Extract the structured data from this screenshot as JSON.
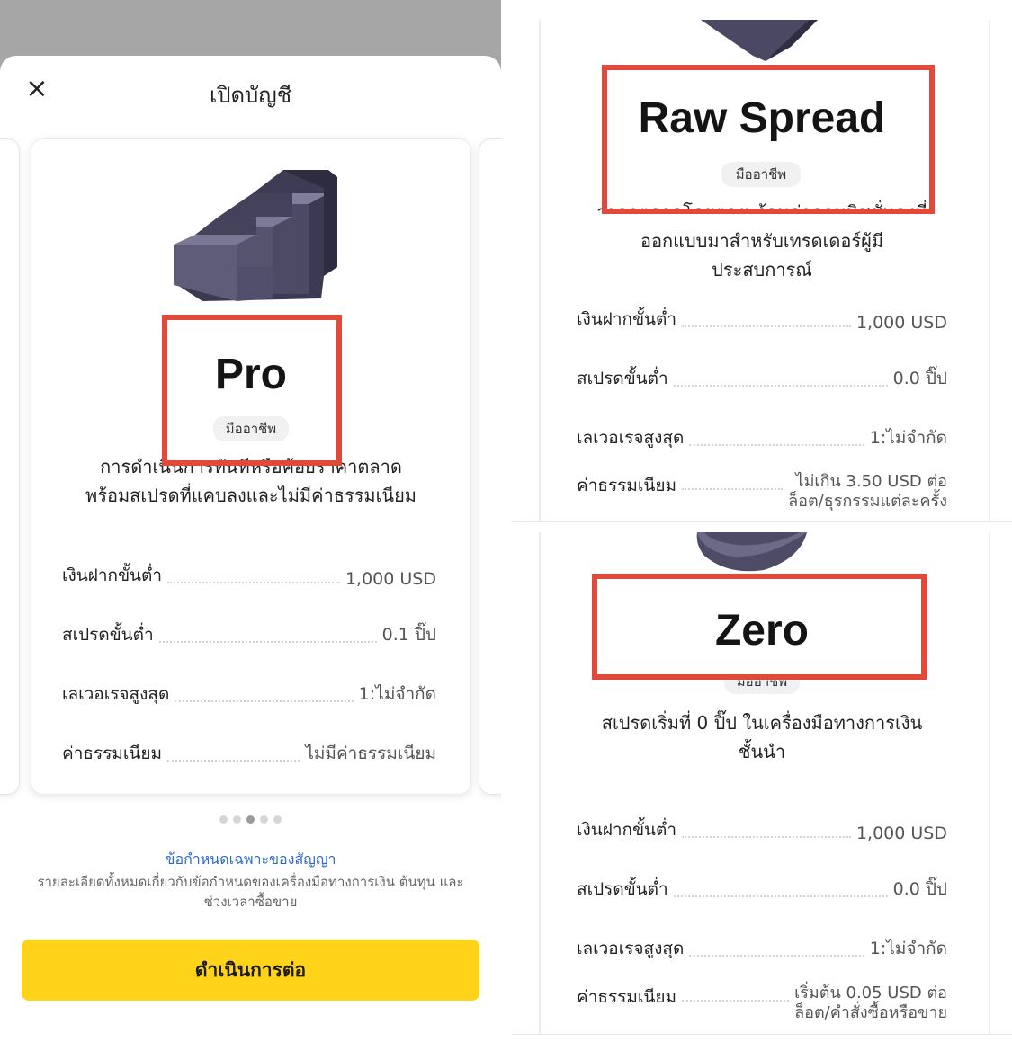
{
  "left": {
    "title": "เปิดบัญชี",
    "close_glyph": "×",
    "account_name": "Pro",
    "tag": "มืออาชีพ",
    "description": [
      "การดำเนินการทันทีหรือค้อยราคาตลาด",
      "พร้อมสเปรดที่แคบลงและไม่มีค่าธรรมเนียม"
    ],
    "rows": [
      {
        "label": "เงินฝากขั้นต่ำ",
        "value": "1,000 USD"
      },
      {
        "label": "สเปรดขั้นต่ำ",
        "value": "0.1 ปิ๊ป"
      },
      {
        "label": "เลเวอเรจสูงสุด",
        "value": "1:ไม่จำกัด"
      },
      {
        "label": "ค่าธรรมเนียม",
        "value": "ไม่มีค่าธรรมเนียม"
      }
    ],
    "pager": {
      "count": 5,
      "active": 2
    },
    "spec_link": "ข้อกำหนดเฉพาะของสัญญา",
    "spec_note": "รายละเอียดทั้งหมดเกี่ยวกับข้อกำหนดของเครื่องมือทางการเงิน ต้นทุน และช่วงเวลาซื้อขาย",
    "continue_button": "ดำเนินการต่อ",
    "icon": "stairs-icon",
    "highlight_color": "#e14a3b",
    "accent_color": "#ffd31a"
  },
  "raw_spread": {
    "account_name": "Raw Spread",
    "tag": "มืออาชีพ",
    "description": [
      "ราคาตลาดโดยตรงพร้อมค่าคอมมิชชั่นคงที่",
      "ออกแบบมาสำหรับเทรดเดอร์ผู้มี",
      "ประสบการณ์"
    ],
    "rows": [
      {
        "label": "เงินฝากขั้นต่ำ",
        "value": "1,000 USD"
      },
      {
        "label": "สเปรดขั้นต่ำ",
        "value": "0.0 ปิ๊ป"
      },
      {
        "label": "เลเวอเรจสูงสุด",
        "value": "1:ไม่จำกัด"
      },
      {
        "label": "ค่าธรรมเนียม",
        "value": "ไม่เกิน 3.50 USD ต่อ",
        "value2": "ล็อต/ธุรกรรมแต่ละครั้ง"
      }
    ]
  },
  "zero": {
    "account_name": "Zero",
    "tag": "มืออาชีพ",
    "description": [
      "สเปรดเริ่มที่ 0 ปิ๊ป ในเครื่องมือทางการเงิน",
      "ชั้นนำ"
    ],
    "rows": [
      {
        "label": "เงินฝากขั้นต่ำ",
        "value": "1,000 USD"
      },
      {
        "label": "สเปรดขั้นต่ำ",
        "value": "0.0 ปิ๊ป"
      },
      {
        "label": "เลเวอเรจสูงสุด",
        "value": "1:ไม่จำกัด"
      },
      {
        "label": "ค่าธรรมเนียม",
        "value": "เริ่มต้น 0.05 USD ต่อ",
        "value2": "ล็อต/คำสั่งซื้อหรือขาย"
      }
    ]
  }
}
